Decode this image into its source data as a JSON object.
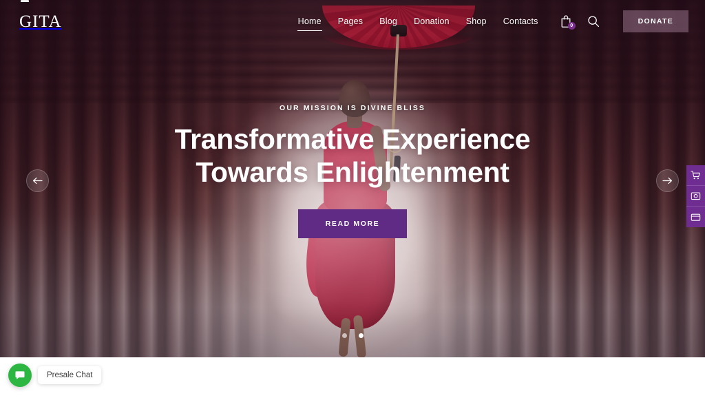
{
  "site": {
    "logo_text": "GITA",
    "logo_icon": "crown-icon"
  },
  "nav": {
    "items": [
      {
        "label": "Home",
        "name": "nav-item-home",
        "active": true
      },
      {
        "label": "Pages",
        "name": "nav-item-pages",
        "active": false
      },
      {
        "label": "Blog",
        "name": "nav-item-blog",
        "active": false
      },
      {
        "label": "Donation",
        "name": "nav-item-donation",
        "active": false
      },
      {
        "label": "Shop",
        "name": "nav-item-shop",
        "active": false
      },
      {
        "label": "Contacts",
        "name": "nav-item-contacts",
        "active": false
      }
    ]
  },
  "header": {
    "cart_icon": "shopping-bag-icon",
    "cart_badge_count": "0",
    "search_icon": "search-icon",
    "donate_label": "DONATE"
  },
  "hero": {
    "eyebrow": "OUR MISSION IS DIVINE BLISS",
    "title_line1": "Transformative Experience",
    "title_line2": "Towards Enlightenment",
    "cta_label": "READ MORE",
    "prev_icon": "arrow-left-icon",
    "next_icon": "arrow-right-icon",
    "slides": [
      {
        "label": "slide-1",
        "active": true
      },
      {
        "label": "slide-2",
        "active": false
      }
    ]
  },
  "side_panel": {
    "buttons": [
      {
        "name": "side-panel-cart-button",
        "icon": "shopping-cart-icon"
      },
      {
        "name": "side-panel-gallery-button",
        "icon": "image-gallery-icon"
      },
      {
        "name": "side-panel-layout-button",
        "icon": "browser-window-icon"
      }
    ]
  },
  "chat": {
    "icon": "chat-bubble-icon",
    "label": "Presale Chat"
  },
  "colors": {
    "accent_purple": "#5f2b84",
    "side_panel_purple": "#6f2d92",
    "chat_green": "#2db742",
    "donate_bg": "rgba(190,150,180,0.40)",
    "text_white": "#ffffff"
  }
}
